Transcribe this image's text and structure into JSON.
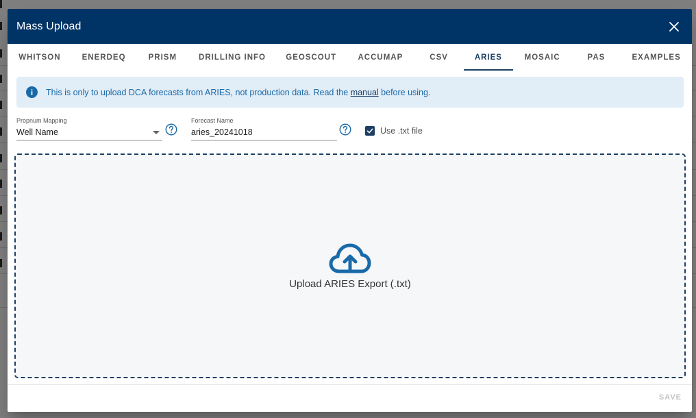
{
  "dialog": {
    "title": "Mass Upload",
    "close_icon": "close-icon"
  },
  "tabs": [
    {
      "label": "WHITSON",
      "active": false
    },
    {
      "label": "ENERDEQ",
      "active": false
    },
    {
      "label": "PRISM",
      "active": false
    },
    {
      "label": "DRILLING INFO",
      "active": false
    },
    {
      "label": "GEOSCOUT",
      "active": false
    },
    {
      "label": "ACCUMAP",
      "active": false
    },
    {
      "label": "CSV",
      "active": false
    },
    {
      "label": "ARIES",
      "active": true
    },
    {
      "label": "MOSAIC",
      "active": false
    },
    {
      "label": "PAS",
      "active": false
    },
    {
      "label": "EXAMPLES",
      "active": false
    }
  ],
  "alert": {
    "icon": "info-icon",
    "text_before": "This is only to upload DCA forecasts from ARIES, not production data. Read the ",
    "link": "manual",
    "text_after": " before using."
  },
  "propnum": {
    "label": "Propnum Mapping",
    "value": "Well Name"
  },
  "forecast": {
    "label": "Forecast Name",
    "value": "aries_20241018"
  },
  "use_txt": {
    "label": "Use .txt file",
    "checked": true
  },
  "dropzone": {
    "icon": "cloud-upload-icon",
    "label": "Upload ARIES Export (.txt)"
  },
  "footer": {
    "save_label": "SAVE"
  },
  "colors": {
    "header": "#003366",
    "accent": "#1c3f63",
    "info": "#1a6aa8",
    "alert_bg": "#e1edf7"
  }
}
